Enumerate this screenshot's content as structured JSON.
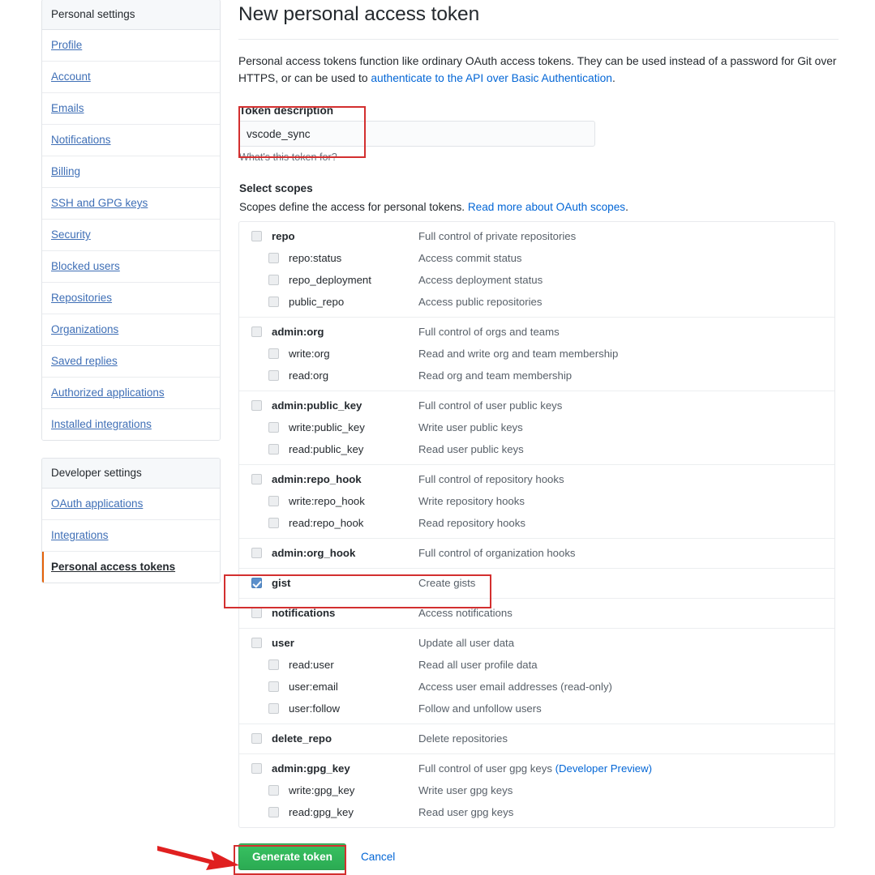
{
  "sidebar": {
    "groups": [
      {
        "header": "Personal settings",
        "items": [
          {
            "label": "Profile",
            "selected": false
          },
          {
            "label": "Account",
            "selected": false
          },
          {
            "label": "Emails",
            "selected": false
          },
          {
            "label": "Notifications",
            "selected": false
          },
          {
            "label": "Billing",
            "selected": false
          },
          {
            "label": "SSH and GPG keys",
            "selected": false
          },
          {
            "label": "Security",
            "selected": false
          },
          {
            "label": "Blocked users",
            "selected": false
          },
          {
            "label": "Repositories",
            "selected": false
          },
          {
            "label": "Organizations",
            "selected": false
          },
          {
            "label": "Saved replies",
            "selected": false
          },
          {
            "label": "Authorized applications",
            "selected": false
          },
          {
            "label": "Installed integrations",
            "selected": false
          }
        ]
      },
      {
        "header": "Developer settings",
        "items": [
          {
            "label": "OAuth applications",
            "selected": false
          },
          {
            "label": "Integrations",
            "selected": false
          },
          {
            "label": "Personal access tokens",
            "selected": true
          }
        ]
      }
    ]
  },
  "main": {
    "page_title": "New personal access token",
    "intro_text_before": "Personal access tokens function like ordinary OAuth access tokens. They can be used instead of a password for Git over HTTPS, or can be used to ",
    "intro_link": "authenticate to the API over Basic Authentication",
    "intro_text_after": ".",
    "token_description_label": "Token description",
    "token_description_value": "vscode_sync",
    "token_description_placeholder": "",
    "token_description_note": "What's this token for?",
    "select_scopes_title": "Select scopes",
    "scopes_sub_before": "Scopes define the access for personal tokens. ",
    "scopes_sub_link": "Read more about OAuth scopes",
    "scopes_sub_after": ".",
    "generate_button": "Generate token",
    "cancel_link": "Cancel"
  },
  "scopes": [
    {
      "rows": [
        {
          "name": "repo",
          "desc": "Full control of private repositories",
          "child": false,
          "checked": false
        },
        {
          "name": "repo:status",
          "desc": "Access commit status",
          "child": true,
          "checked": false
        },
        {
          "name": "repo_deployment",
          "desc": "Access deployment status",
          "child": true,
          "checked": false
        },
        {
          "name": "public_repo",
          "desc": "Access public repositories",
          "child": true,
          "checked": false
        }
      ]
    },
    {
      "rows": [
        {
          "name": "admin:org",
          "desc": "Full control of orgs and teams",
          "child": false,
          "checked": false
        },
        {
          "name": "write:org",
          "desc": "Read and write org and team membership",
          "child": true,
          "checked": false
        },
        {
          "name": "read:org",
          "desc": "Read org and team membership",
          "child": true,
          "checked": false
        }
      ]
    },
    {
      "rows": [
        {
          "name": "admin:public_key",
          "desc": "Full control of user public keys",
          "child": false,
          "checked": false
        },
        {
          "name": "write:public_key",
          "desc": "Write user public keys",
          "child": true,
          "checked": false
        },
        {
          "name": "read:public_key",
          "desc": "Read user public keys",
          "child": true,
          "checked": false
        }
      ]
    },
    {
      "rows": [
        {
          "name": "admin:repo_hook",
          "desc": "Full control of repository hooks",
          "child": false,
          "checked": false
        },
        {
          "name": "write:repo_hook",
          "desc": "Write repository hooks",
          "child": true,
          "checked": false
        },
        {
          "name": "read:repo_hook",
          "desc": "Read repository hooks",
          "child": true,
          "checked": false
        }
      ]
    },
    {
      "rows": [
        {
          "name": "admin:org_hook",
          "desc": "Full control of organization hooks",
          "child": false,
          "checked": false
        }
      ]
    },
    {
      "rows": [
        {
          "name": "gist",
          "desc": "Create gists",
          "child": false,
          "checked": true
        }
      ]
    },
    {
      "rows": [
        {
          "name": "notifications",
          "desc": "Access notifications",
          "child": false,
          "checked": false
        }
      ]
    },
    {
      "rows": [
        {
          "name": "user",
          "desc": "Update all user data",
          "child": false,
          "checked": false
        },
        {
          "name": "read:user",
          "desc": "Read all user profile data",
          "child": true,
          "checked": false
        },
        {
          "name": "user:email",
          "desc": "Access user email addresses (read-only)",
          "child": true,
          "checked": false
        },
        {
          "name": "user:follow",
          "desc": "Follow and unfollow users",
          "child": true,
          "checked": false
        }
      ]
    },
    {
      "rows": [
        {
          "name": "delete_repo",
          "desc": "Delete repositories",
          "child": false,
          "checked": false
        }
      ]
    },
    {
      "rows": [
        {
          "name": "admin:gpg_key",
          "desc": "Full control of user gpg keys ",
          "desc_link": "(Developer Preview)",
          "child": false,
          "checked": false
        },
        {
          "name": "write:gpg_key",
          "desc": "Write user gpg keys",
          "child": true,
          "checked": false
        },
        {
          "name": "read:gpg_key",
          "desc": "Read user gpg keys",
          "child": true,
          "checked": false
        }
      ]
    }
  ],
  "annotations": {
    "color": "#d32f2f",
    "highlight_token_description": true,
    "highlight_gist_scope": true,
    "highlight_generate_button": true,
    "arrow_points_to": "Generate token"
  }
}
